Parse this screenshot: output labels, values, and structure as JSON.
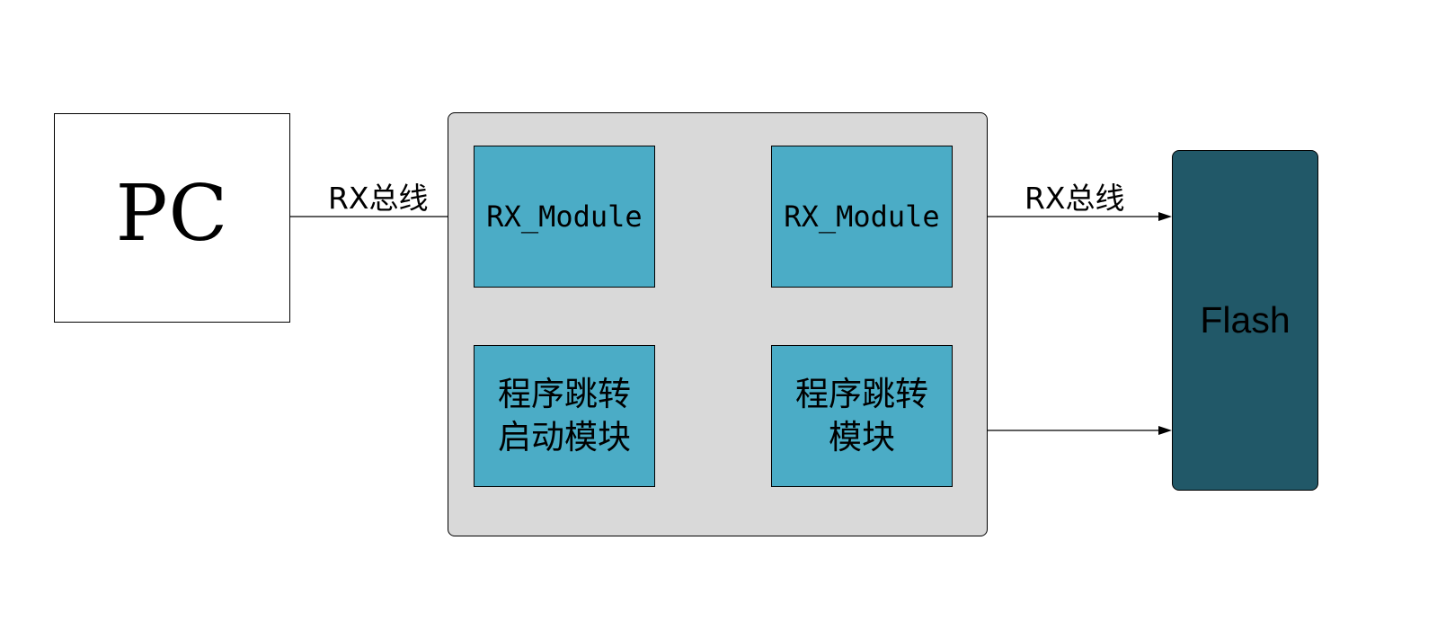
{
  "pc": {
    "label": "PC"
  },
  "bus_labels": {
    "left": "RX总线",
    "right": "RX总线"
  },
  "modules": {
    "rx_module_1": "RX_Module",
    "rx_module_2": "RX_Module",
    "jump_start": "程序跳转启动模块",
    "jump": "程序跳转模块"
  },
  "flash": {
    "label": "Flash"
  },
  "colors": {
    "container_fill": "#d9d9d9",
    "module_fill": "#4bacc6",
    "flash_fill": "#215868",
    "line": "#000000",
    "pc_fill": "#ffffff"
  }
}
